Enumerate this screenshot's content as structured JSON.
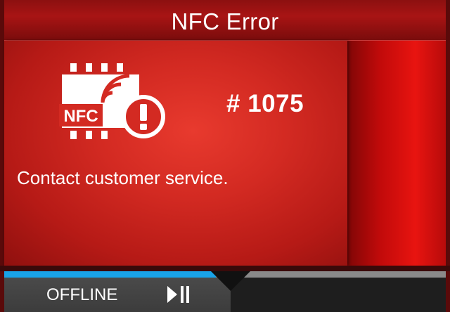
{
  "header": {
    "title": "NFC Error"
  },
  "error": {
    "icon_badge_text": "NFC",
    "code": "# 1075",
    "message": "Contact customer service."
  },
  "status": {
    "label": "OFFLINE",
    "progress_fraction": 0.48
  },
  "icons": {
    "error_icon": "nfc-error-icon",
    "status_icon": "play-pause-icon"
  },
  "colors": {
    "accent_blue": "#19a3e8",
    "error_red": "#d32a22"
  }
}
